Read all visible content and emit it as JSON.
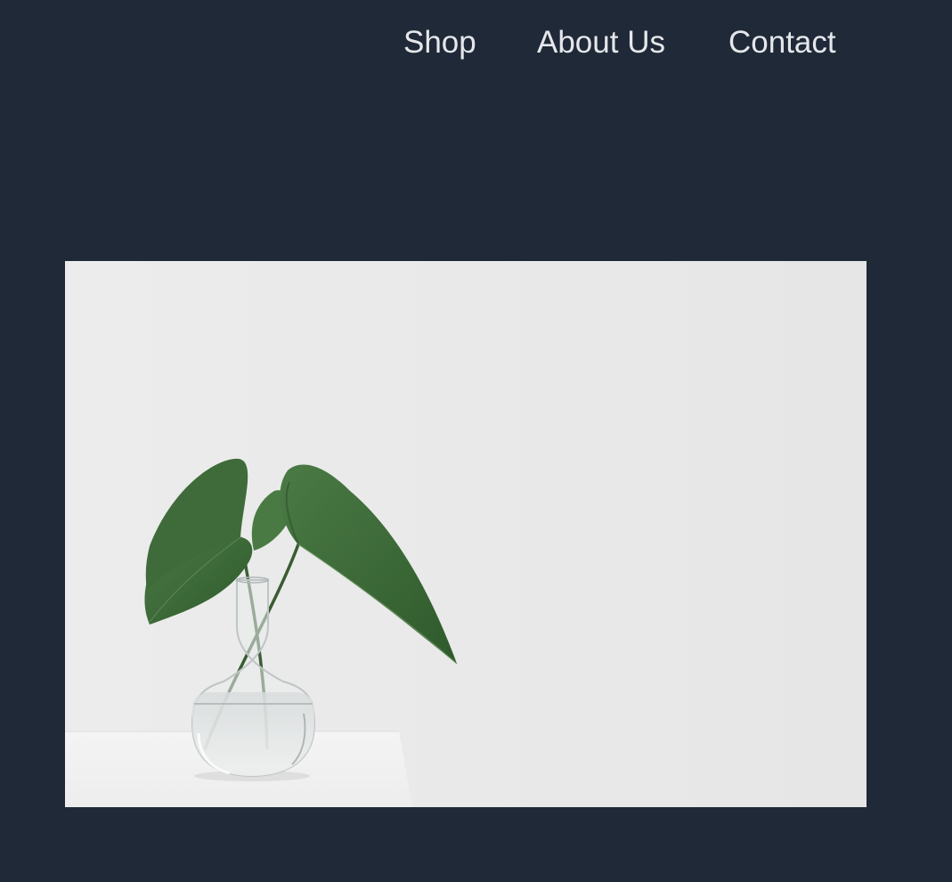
{
  "nav": {
    "links": [
      {
        "label": "Shop"
      },
      {
        "label": "About Us"
      },
      {
        "label": "Contact"
      }
    ]
  },
  "hero": {
    "image_subject": "plant-in-glass-vase-photo",
    "colors": {
      "page_background": "#1f2937",
      "nav_text": "#e5e7eb",
      "photo_background": "#e8e8e8",
      "leaf": "#3f6b3a"
    }
  }
}
